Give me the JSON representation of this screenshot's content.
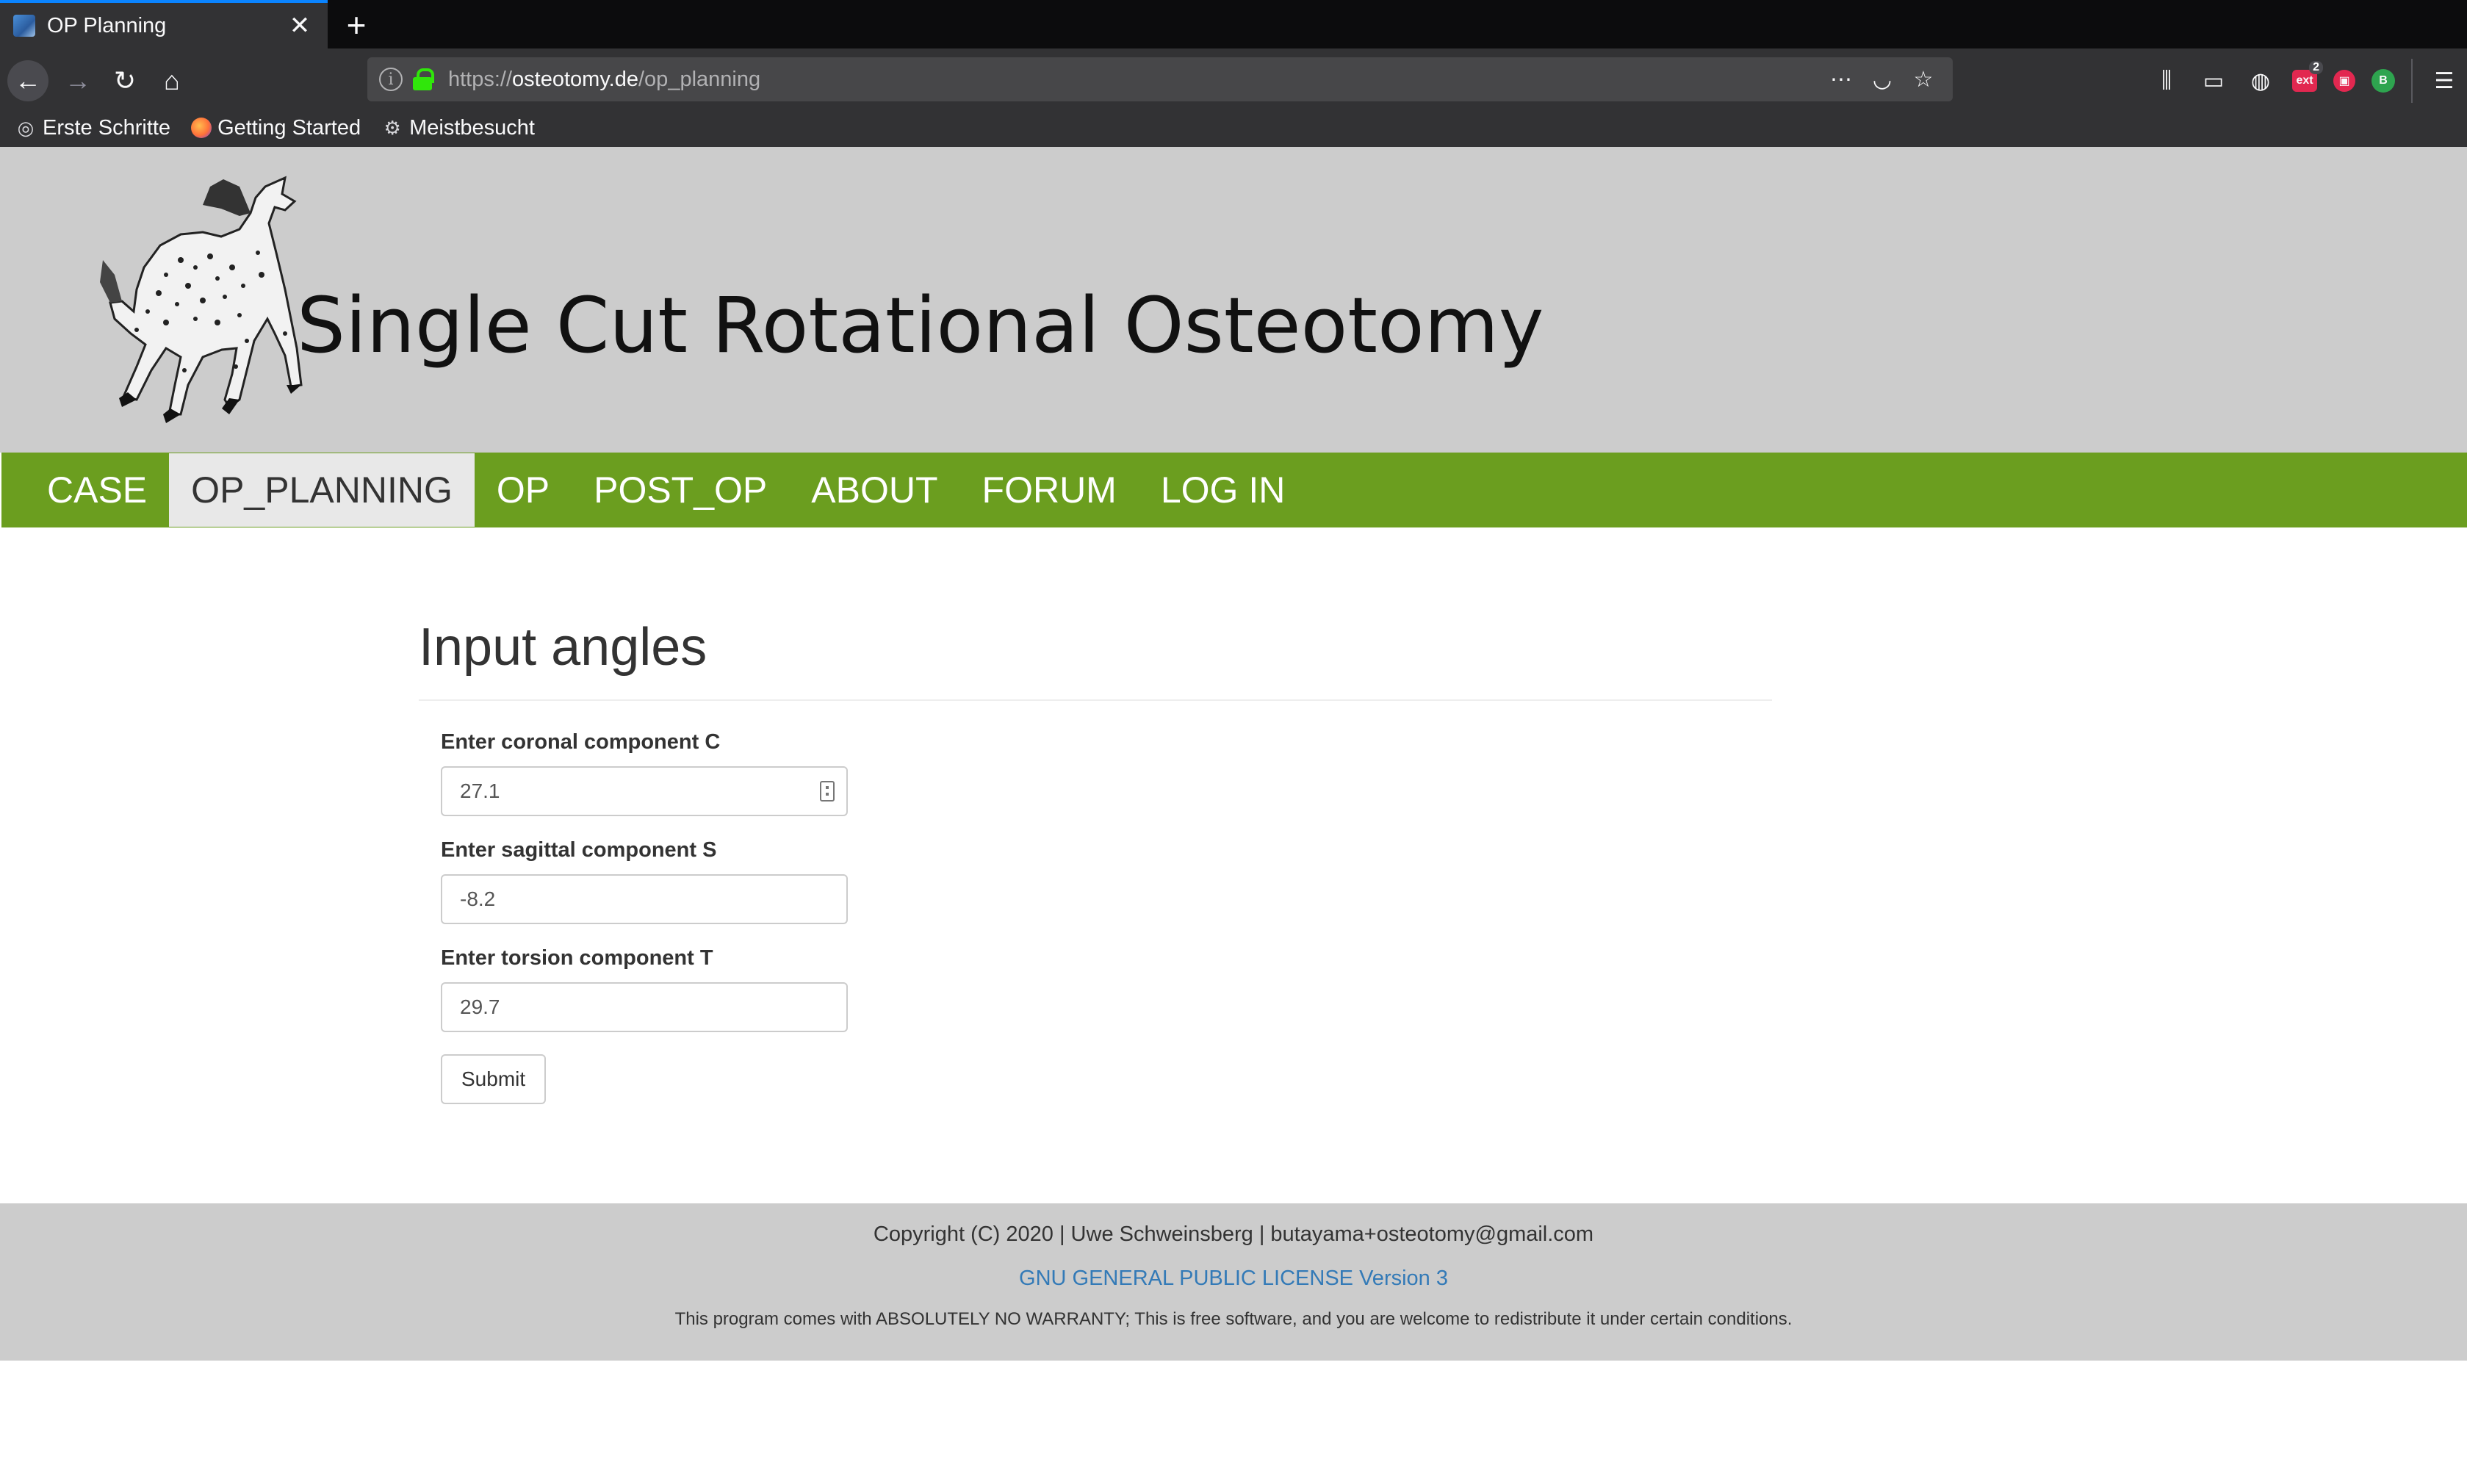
{
  "browser": {
    "tab_title": "OP Planning",
    "url_scheme": "https://",
    "url_host": "osteotomy.de",
    "url_path": "/op_planning",
    "bookmarks": [
      "Erste Schritte",
      "Getting Started",
      "Meistbesucht"
    ],
    "extension_badge": "2"
  },
  "site": {
    "title": "Single Cut Rotational Osteotomy"
  },
  "nav": {
    "items": [
      "CASE",
      "OP_PLANNING",
      "OP",
      "POST_OP",
      "ABOUT",
      "FORUM",
      "LOG IN"
    ],
    "active": "OP_PLANNING"
  },
  "form": {
    "heading": "Input angles",
    "coronal_label": "Enter coronal component C",
    "coronal_value": "27.1",
    "sagittal_label": "Enter sagittal component S",
    "sagittal_value": "-8.2",
    "torsion_label": "Enter torsion component T",
    "torsion_value": "29.7",
    "submit_label": "Submit"
  },
  "footer": {
    "copyright": "Copyright (C) 2020 | Uwe Schweinsberg | butayama+osteotomy@gmail.com",
    "license": "GNU GENERAL PUBLIC LICENSE Version 3",
    "warranty": "This program comes with ABSOLUTELY NO WARRANTY; This is free software, and you are welcome to redistribute it under certain conditions."
  },
  "colors": {
    "nav_green": "#6b9e1f",
    "banner_gray": "#cccccc",
    "link_blue": "#337ab7",
    "chrome_dark": "#323234"
  }
}
